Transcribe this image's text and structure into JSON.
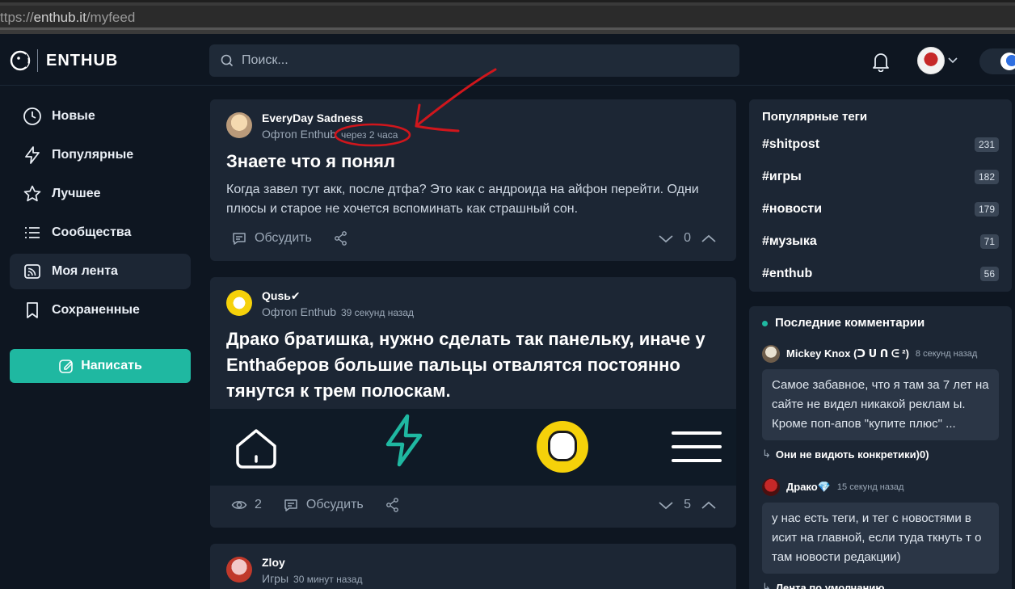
{
  "browser": {
    "url_prefix": "ttps://",
    "url_host": "enthub.it",
    "url_path": "/myfeed"
  },
  "header": {
    "logo_text": "ENTHUB",
    "search_placeholder": "Поиск..."
  },
  "sidebar": {
    "items": [
      {
        "label": "Новые",
        "icon": "clock-icon"
      },
      {
        "label": "Популярные",
        "icon": "lightning-icon"
      },
      {
        "label": "Лучшее",
        "icon": "star-icon"
      },
      {
        "label": "Сообщества",
        "icon": "list-icon"
      },
      {
        "label": "Моя лента",
        "icon": "feed-icon",
        "active": true
      },
      {
        "label": "Сохраненные",
        "icon": "bookmark-icon"
      }
    ],
    "write_label": "Написать"
  },
  "posts": [
    {
      "author": "EveryDay Sadness",
      "community": "Офтоп Enthub",
      "time": "через 2 часа",
      "title": "Знаете что я понял",
      "body": "Когда завел тут акк, после дтфа? Это как с андроида на айфон перейти. Одни плюсы и старое не хочется вспоминать как страшный сон.",
      "discuss": "Обсудить",
      "votes": "0"
    },
    {
      "author": "Qusь✔",
      "community": "Офтоп Enthub",
      "time": "39 секунд назад",
      "title": "Драко братишка, нужно сделать так панельку, иначе у Enthаберов большие пальцы отвалятся постоянно тянутся к трем полоскам.",
      "views": "2",
      "discuss": "Обсудить",
      "votes": "5"
    },
    {
      "author": "Zloy",
      "community": "Игры",
      "time": "30 минут назад"
    }
  ],
  "popular_tags": {
    "title": "Популярные теги",
    "tags": [
      {
        "tag": "#shitpost",
        "count": "231"
      },
      {
        "tag": "#игры",
        "count": "182"
      },
      {
        "tag": "#новости",
        "count": "179"
      },
      {
        "tag": "#музыка",
        "count": "71"
      },
      {
        "tag": "#enthub",
        "count": "56"
      }
    ]
  },
  "recent_comments": {
    "title": "Последние комментарии",
    "comments": [
      {
        "author": "Mickey Knox (ᑐ ᑌ ᑎ ᕮ ²)",
        "time": "8 секунд назад",
        "text": "Самое забавное, что я там за 7 лет на сайте не видел никакой реклам ы. Кроме поп-апов \"купите плюс\" ...",
        "reply_to": "Они не видють конкретики)0)"
      },
      {
        "author": "Драко💎",
        "time": "15 секунд назад",
        "text": "у нас есть теги, и тег с новостями в исит на главной, если туда ткнуть т о там новости редакции)",
        "reply_to": "Лента по умолчанию"
      }
    ]
  },
  "colors": {
    "accent": "#1fb8a1",
    "card": "#1c2634",
    "bg": "#0e1621",
    "annotation": "#d0161c"
  }
}
